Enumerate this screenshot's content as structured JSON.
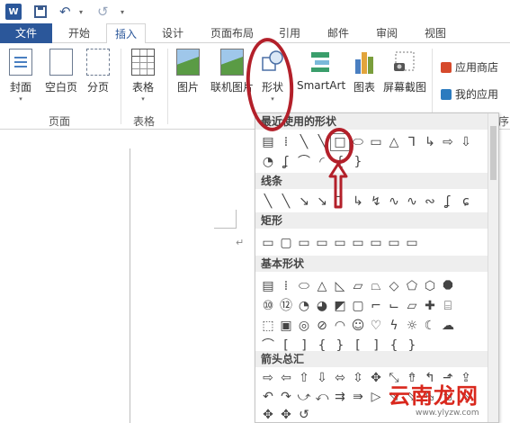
{
  "quick_access": {
    "logo_text": "W",
    "undo_glyph": "↶",
    "redo_glyph": "↺",
    "drop_glyph": "▾"
  },
  "tabs": [
    {
      "id": "file",
      "label": "文件"
    },
    {
      "id": "home",
      "label": "开始"
    },
    {
      "id": "insert",
      "label": "插入"
    },
    {
      "id": "design",
      "label": "设计"
    },
    {
      "id": "layout",
      "label": "页面布局"
    },
    {
      "id": "references",
      "label": "引用"
    },
    {
      "id": "mailings",
      "label": "邮件"
    },
    {
      "id": "review",
      "label": "审阅"
    },
    {
      "id": "view",
      "label": "视图"
    }
  ],
  "active_tab": "插入",
  "ribbon": {
    "pages_group": {
      "label": "页面",
      "buttons": [
        "封面",
        "空白页",
        "分页"
      ]
    },
    "tables_group": {
      "label": "表格",
      "buttons": [
        "表格"
      ]
    },
    "illustrations": {
      "buttons": [
        "图片",
        "联机图片",
        "形状",
        "SmartArt",
        "图表",
        "屏幕截图"
      ]
    },
    "apps": {
      "store": "应用商店",
      "my_apps": "我的应用",
      "partial_label": "序"
    }
  },
  "gallery": {
    "sections": [
      {
        "title": "最近使用的形状",
        "rows": [
          [
            "▤",
            "⁞",
            "╲",
            "╲",
            "□",
            "⬭",
            "▭",
            "△",
            "⅂",
            "↳",
            "⇨",
            "⇩"
          ],
          [
            "◔",
            "ʆ",
            "⌒",
            "◜",
            "{",
            "}"
          ]
        ]
      },
      {
        "title": "线条",
        "rows": [
          [
            "╲",
            "╲",
            "↘",
            "↘",
            "⅂",
            "↳",
            "↯",
            "∿",
            "∿",
            "∾",
            "ʆ",
            "ɕ"
          ]
        ]
      },
      {
        "title": "矩形",
        "rows": [
          [
            "▭",
            "▢",
            "▭",
            "▭",
            "▭",
            "▭",
            "▭",
            "▭",
            "▭"
          ]
        ]
      },
      {
        "title": "基本形状",
        "rows": [
          [
            "▤",
            "⁞",
            "⬭",
            "△",
            "◺",
            "▱",
            "⏢",
            "◇",
            "⬠",
            "⬡",
            "⯃"
          ],
          [
            "⑩",
            "⑫",
            "◔",
            "◕",
            "◩",
            "▢",
            "⌐",
            "⌙",
            "▱",
            "✚",
            "⌸"
          ],
          [
            "⬚",
            "▣",
            "◎",
            "⊘",
            "◠",
            "☺",
            "♡",
            "ϟ",
            "☼",
            "☾",
            "☁"
          ],
          [
            "⌒",
            "[",
            "]",
            "{",
            "}",
            "[",
            "]",
            "{",
            "}"
          ]
        ]
      },
      {
        "title": "箭头总汇",
        "rows": [
          [
            "⇨",
            "⇦",
            "⇧",
            "⇩",
            "⬄",
            "⇳",
            "✥",
            "⤡",
            "⇮",
            "↰",
            "⬏",
            "⇪"
          ],
          [
            "↶",
            "↷",
            "⤻",
            "⤺",
            "⇉",
            "⇛",
            "▷",
            "⬂",
            "⬂",
            "⬂",
            "⬂",
            "⬂"
          ],
          [
            "✥",
            "✥",
            "↺"
          ]
        ]
      }
    ]
  },
  "watermark": {
    "text": "云南龙网",
    "url": "www.ylyzw.com"
  },
  "colors": {
    "file_tab": "#2b579a",
    "annotation_red": "#b3202a",
    "watermark_red": "#d9281d"
  }
}
